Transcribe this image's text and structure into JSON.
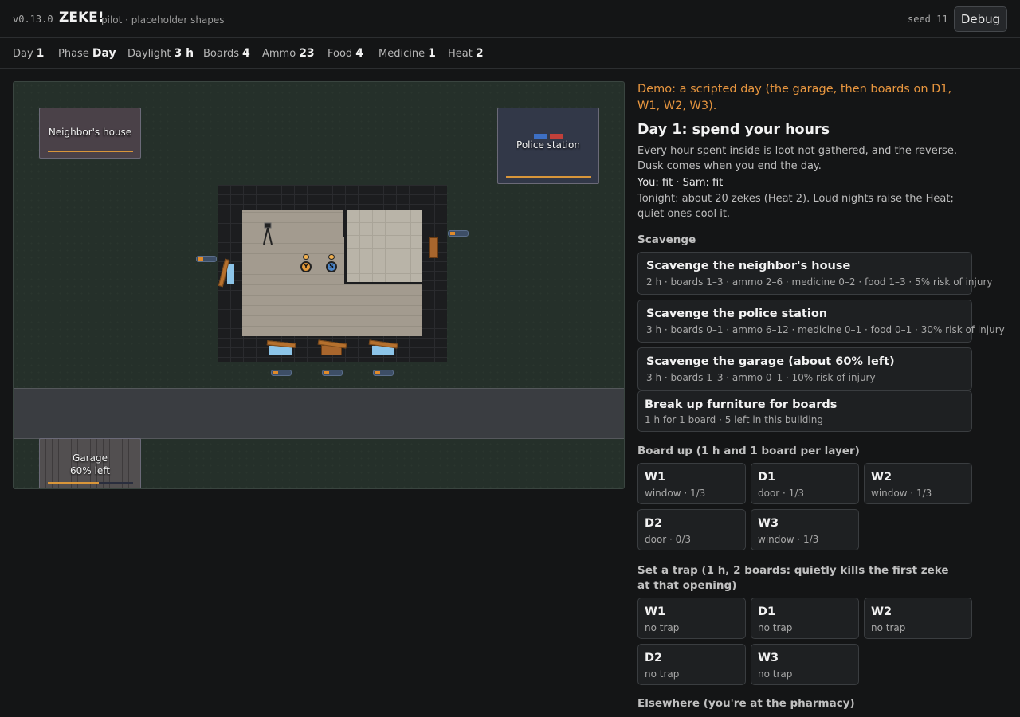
{
  "header": {
    "version": "v0.13.0",
    "title": "ZEKE!",
    "subtitle": "pilot · placeholder shapes",
    "seed": "seed 11",
    "debug_label": "Debug"
  },
  "stats": [
    {
      "label": "Day",
      "value": "1"
    },
    {
      "label": "Phase",
      "value": "Day"
    },
    {
      "label": "Daylight",
      "value": "3 h"
    },
    {
      "label": "Boards",
      "value": "4"
    },
    {
      "label": "Ammo",
      "value": "23"
    },
    {
      "label": "Food",
      "value": "4"
    },
    {
      "label": "Medicine",
      "value": "1"
    },
    {
      "label": "Heat",
      "value": "2"
    }
  ],
  "map": {
    "neighbor_label": "Neighbor's house",
    "police_label": "Police station",
    "garage_label": "Garage",
    "garage_status": "60% left",
    "garage_remaining": 0.6,
    "token_you": "Y",
    "token_sam": "S"
  },
  "panel": {
    "demo": "Demo: a scripted day (the garage, then boards on D1, W1, W2, W3).",
    "heading": "Day 1: spend your hours",
    "desc": "Every hour spent inside is loot not gathered, and the reverse. Dusk comes when you end the day.",
    "you": "You: fit · Sam: fit",
    "tonight": "Tonight: about 20 zekes (Heat 2). Loud nights raise the Heat; quiet ones cool it.",
    "scavenge_title": "Scavenge",
    "scavenge": [
      {
        "title": "Scavenge the neighbor's house",
        "sub": "2 h · boards 1–3 · ammo 2–6 · medicine 0–2 · food 1–3 · 5% risk of injury"
      },
      {
        "title": "Scavenge the police station",
        "sub": "3 h · boards 0–1 · ammo 6–12 · medicine 0–1 · food 0–1 · 30% risk of injury"
      },
      {
        "title": "Scavenge the garage (about 60% left)",
        "sub": "3 h · boards 1–3 · ammo 0–1 · 10% risk of injury"
      },
      {
        "title": "Break up furniture for boards",
        "sub": "1 h for 1 board · 5 left in this building"
      }
    ],
    "board_title": "Board up (1 h and 1 board per layer)",
    "board": [
      {
        "title": "W1",
        "sub": "window · 1/3"
      },
      {
        "title": "D1",
        "sub": "door · 1/3"
      },
      {
        "title": "W2",
        "sub": "window · 1/3"
      },
      {
        "title": "D2",
        "sub": "door · 0/3"
      },
      {
        "title": "W3",
        "sub": "window · 1/3"
      }
    ],
    "trap_title": "Set a trap (1 h, 2 boards: quietly kills the first zeke at that opening)",
    "trap": [
      {
        "title": "W1",
        "sub": "no trap"
      },
      {
        "title": "D1",
        "sub": "no trap"
      },
      {
        "title": "W2",
        "sub": "no trap"
      },
      {
        "title": "D2",
        "sub": "no trap"
      },
      {
        "title": "W3",
        "sub": "no trap"
      }
    ],
    "elsewhere_title": "Elsewhere (you're at the pharmacy)"
  }
}
